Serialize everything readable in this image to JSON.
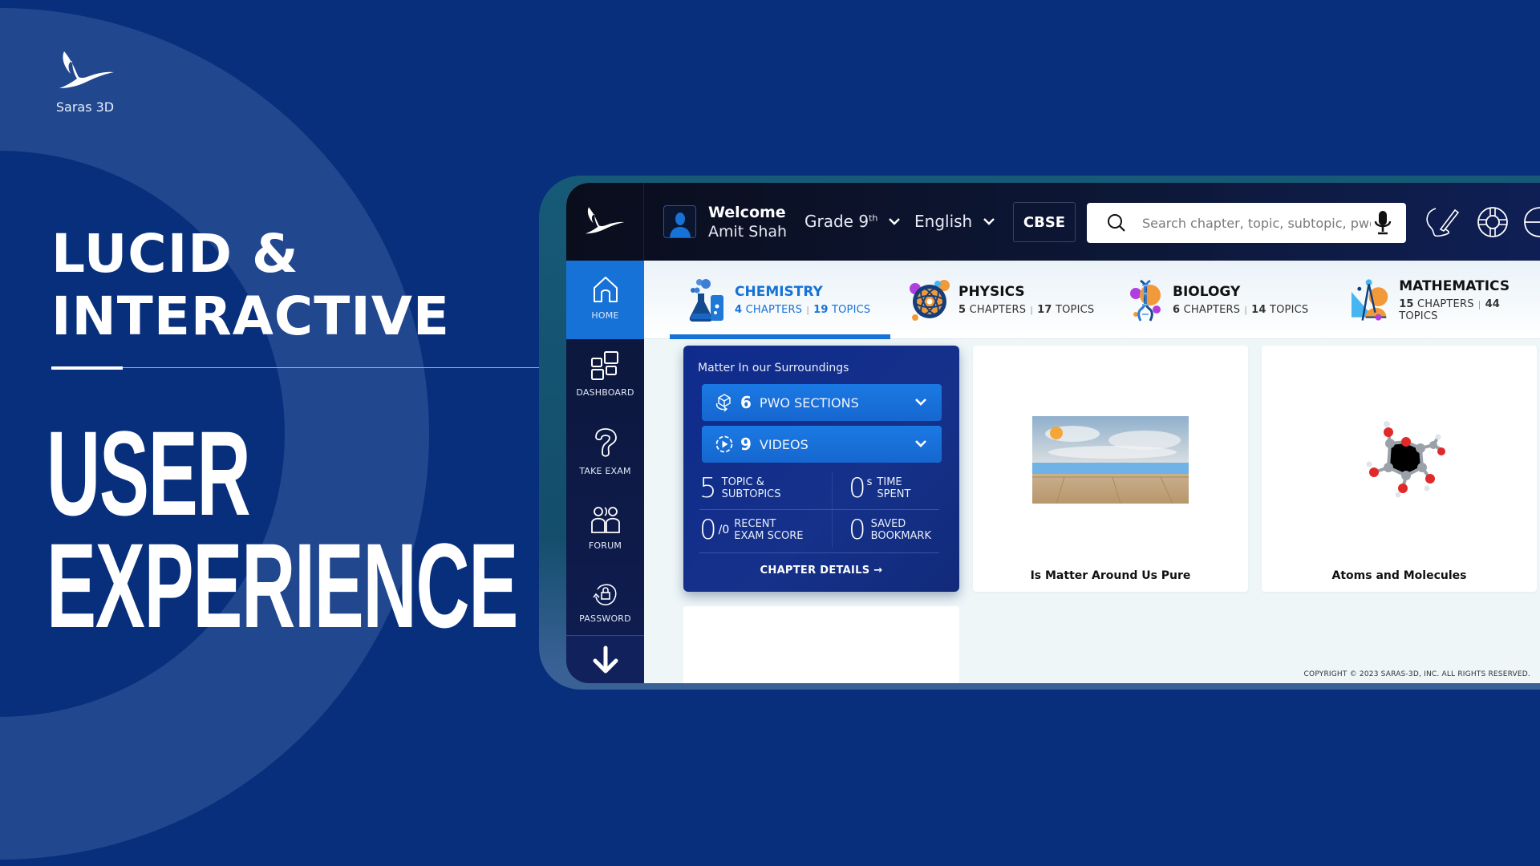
{
  "slide": {
    "brand_name": "Saras 3D",
    "headline_lines": [
      "LUCID &",
      "INTERACTIVE"
    ],
    "ux_lines": [
      "USER",
      "EXPERIENCE"
    ]
  },
  "app": {
    "header": {
      "welcome_label": "Welcome",
      "user_name": "Amit Shah",
      "grade_label": "Grade 9",
      "grade_suffix": "th",
      "language": "English",
      "board": "CBSE",
      "search_placeholder": "Search chapter, topic, subtopic, pwo..."
    },
    "sidebar": {
      "items": [
        {
          "label": "HOME",
          "icon": "home-icon",
          "active": true
        },
        {
          "label": "DASHBOARD",
          "icon": "dashboard-icon"
        },
        {
          "label": "TAKE EXAM",
          "icon": "question-icon"
        },
        {
          "label": "FORUM",
          "icon": "forum-icon"
        },
        {
          "label": "PASSWORD",
          "icon": "lock-reset-icon"
        }
      ],
      "scroll_down": "arrow-down-icon"
    },
    "subjects": [
      {
        "name": "CHEMISTRY",
        "chapters": "4",
        "chapters_label": "CHAPTERS",
        "topics": "19",
        "topics_label": "TOPICS",
        "active": true
      },
      {
        "name": "PHYSICS",
        "chapters": "5",
        "chapters_label": "CHAPTERS",
        "topics": "17",
        "topics_label": "TOPICS"
      },
      {
        "name": "BIOLOGY",
        "chapters": "6",
        "chapters_label": "CHAPTERS",
        "topics": "14",
        "topics_label": "TOPICS"
      },
      {
        "name": "MATHEMATICS",
        "chapters": "15",
        "chapters_label": "CHAPTERS",
        "topics": "44",
        "topics_label": "TOPICS"
      }
    ],
    "chapter_card": {
      "title": "Matter In our Surroundings",
      "pwo": {
        "count": "6",
        "label": "PWO SECTIONS"
      },
      "videos": {
        "count": "9",
        "label": "VIDEOS"
      },
      "stats": {
        "topics": {
          "value": "5",
          "label1": "TOPIC &",
          "label2": "SUBTOPICS"
        },
        "time": {
          "value": "0",
          "unit": "s",
          "label1": "TIME",
          "label2": "SPENT"
        },
        "exam": {
          "value": "0",
          "denominator": "/0",
          "label1": "RECENT",
          "label2": "EXAM SCORE"
        },
        "bookmark": {
          "value": "0",
          "label1": "SAVED",
          "label2": "BOOKMARK"
        }
      },
      "details_label": "CHAPTER DETAILS",
      "details_arrow": "→"
    },
    "chapters": [
      {
        "title": "Is Matter Around Us Pure"
      },
      {
        "title": "Atoms and Molecules"
      }
    ],
    "copyright": "COPYRIGHT © 2023 SARAS-3D, INC. ALL RIGHTS RESERVED."
  }
}
